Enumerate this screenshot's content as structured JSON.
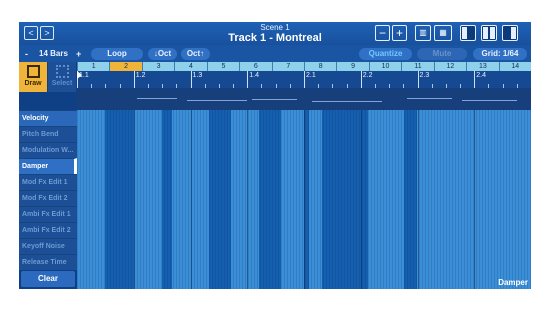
{
  "header": {
    "scene": "Scene 1",
    "track": "Track 1 - Montreal",
    "nav_back": "<",
    "nav_forward": ">"
  },
  "toolbar": {
    "minus": "-",
    "bars_label": "14 Bars",
    "plus": "+",
    "loop": "Loop",
    "oct_down": "↓Oct",
    "oct_up": "Oct↑",
    "quantize": "Quantize",
    "mute": "Mute",
    "grid": "Grid: 1/64"
  },
  "tools": {
    "draw": "Draw",
    "select": "Select"
  },
  "bars": [
    "1",
    "2",
    "3",
    "4",
    "5",
    "6",
    "7",
    "8",
    "9",
    "10",
    "11",
    "12",
    "13",
    "14"
  ],
  "selected_bar": "2",
  "beats": [
    "1.1",
    "1.2",
    "1.3",
    "1.4",
    "2.1",
    "2.2",
    "2.3",
    "2.4"
  ],
  "controllers": [
    "Velocity",
    "Pitch Bend",
    "Modulation W...",
    "Damper",
    "Mod Fx Edit 1",
    "Mod Fx Edit 2",
    "Ambi Fx Edit 1",
    "Ambi Fx Edit 2",
    "Keyoff Noise",
    "Release Time"
  ],
  "active_controller": "Damper",
  "clear": "Clear",
  "lane_label": "Damper",
  "damper_lane": {
    "range": [
      0,
      1
    ],
    "low_segments": [
      [
        1.0625,
        1.125
      ],
      [
        1.1875,
        1.21
      ],
      [
        1.29,
        1.34
      ],
      [
        1.4,
        1.45
      ],
      [
        1.5,
        1.51
      ],
      [
        1.54,
        1.64
      ],
      [
        1.72,
        1.75
      ]
    ]
  },
  "colors": {
    "accent": "#f0b43a",
    "high": "#3b8fd8",
    "low": "#145fb0",
    "quantize": "#74c7ff"
  }
}
